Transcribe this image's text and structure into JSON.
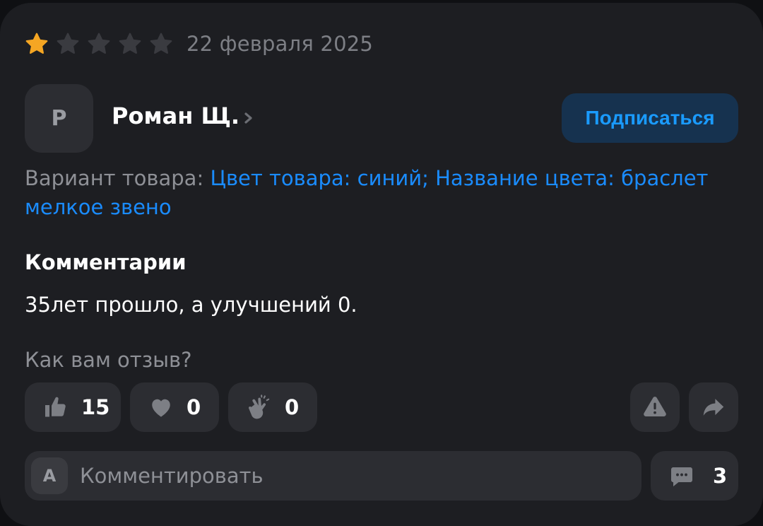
{
  "review": {
    "rating": 1,
    "rating_max": 5,
    "date": "22 февраля 2025",
    "author": {
      "initial": "Р",
      "name": "Роман Щ.",
      "subscribe_label": "Подписаться"
    },
    "variant": {
      "label": "Вариант товара:",
      "value": "Цвет товара: синий; Название цвета: браслет мелкое звено"
    },
    "comments_title": "Комментарии",
    "comment_text": "35лет прошло, а улучшений 0.",
    "question": "Как вам отзыв?",
    "reactions": {
      "like_count": "15",
      "heart_count": "0",
      "clap_count": "0"
    },
    "comment_input": {
      "avatar_initial": "А",
      "placeholder": "Комментировать"
    },
    "comments_count": "3"
  },
  "colors": {
    "star_active": "#f5a623",
    "star_inactive": "#3a3b40",
    "accent": "#1a8cff"
  },
  "icons": [
    "star-icon",
    "chevron-right-icon",
    "thumbs-up-icon",
    "heart-icon",
    "clap-icon",
    "warning-icon",
    "share-icon",
    "chat-bubble-icon"
  ]
}
